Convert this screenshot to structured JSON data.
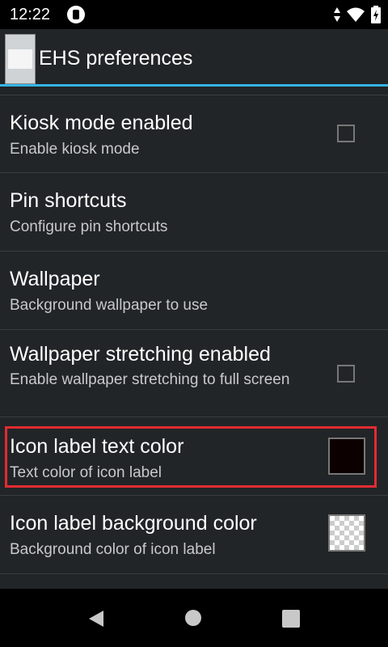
{
  "status": {
    "time": "12:22"
  },
  "actionbar": {
    "title": "EHS preferences"
  },
  "preferences": [
    {
      "title": "Kiosk mode enabled",
      "summary": "Enable kiosk mode",
      "widget": "checkbox",
      "checked": false
    },
    {
      "title": "Pin shortcuts",
      "summary": "Configure pin shortcuts"
    },
    {
      "title": "Wallpaper",
      "summary": "Background wallpaper to use"
    },
    {
      "title": "Wallpaper stretching enabled",
      "summary": "Enable wallpaper stretching to full screen",
      "widget": "checkbox",
      "checked": false
    },
    {
      "title": "Icon label text color",
      "summary": "Text color of icon label",
      "widget": "color-swatch",
      "color": "#0d0000"
    },
    {
      "title": "Icon label background color",
      "summary": "Background color of icon label",
      "widget": "color-swatch",
      "color": "transparent"
    }
  ],
  "colors": {
    "accent": "#33b5e5",
    "highlight": "#e22b32",
    "background": "#222527"
  },
  "navbar": {
    "icons": [
      "back-icon",
      "home-icon",
      "recents-icon"
    ]
  }
}
